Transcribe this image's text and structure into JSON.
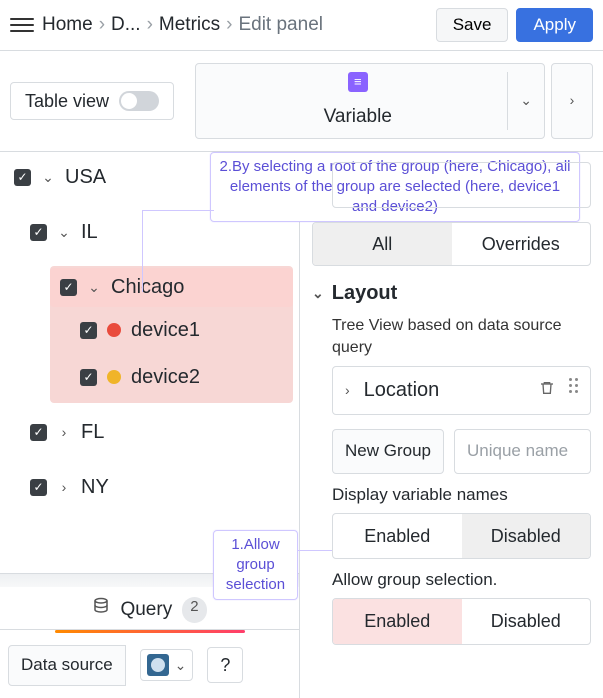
{
  "header": {
    "breadcrumbs": [
      "Home",
      "D...",
      "Metrics",
      "Edit panel"
    ],
    "save_label": "Save",
    "apply_label": "Apply"
  },
  "toolbar": {
    "table_view_label": "Table view",
    "panel_type": "Variable"
  },
  "tree": {
    "nodes": [
      {
        "label": "USA",
        "expanded": true,
        "checked": true,
        "depth": 0
      },
      {
        "label": "IL",
        "expanded": true,
        "checked": true,
        "depth": 1
      },
      {
        "label": "Chicago",
        "expanded": true,
        "checked": true,
        "depth": 2,
        "highlight": true
      },
      {
        "label": "device1",
        "checked": true,
        "depth": 3,
        "dot": "red",
        "highlight": true
      },
      {
        "label": "device2",
        "checked": true,
        "depth": 3,
        "dot": "amber",
        "highlight": true
      },
      {
        "label": "FL",
        "expanded": false,
        "checked": true,
        "depth": 1
      },
      {
        "label": "NY",
        "expanded": false,
        "checked": true,
        "depth": 1
      }
    ]
  },
  "query_tab": {
    "label": "Query",
    "count": "2",
    "datasource_label": "Data source"
  },
  "panel": {
    "tabs": {
      "all": "All",
      "overrides": "Overrides",
      "active": "all"
    },
    "layout_section": "Layout",
    "tree_desc": "Tree View based on data source query",
    "location_label": "Location",
    "new_group_label": "New Group",
    "new_group_placeholder": "Unique name",
    "display_var_label": "Display variable names",
    "display_var": {
      "enabled": "Enabled",
      "disabled": "Disabled",
      "value": "disabled"
    },
    "allow_group_label": "Allow group selection.",
    "allow_group": {
      "enabled": "Enabled",
      "disabled": "Disabled",
      "value": "enabled"
    }
  },
  "callouts": {
    "c1": "1.Allow group selection",
    "c2": "2.By selecting a root of the group (here, Chicago), all elements of the group are selected (here, device1 and device2)"
  }
}
